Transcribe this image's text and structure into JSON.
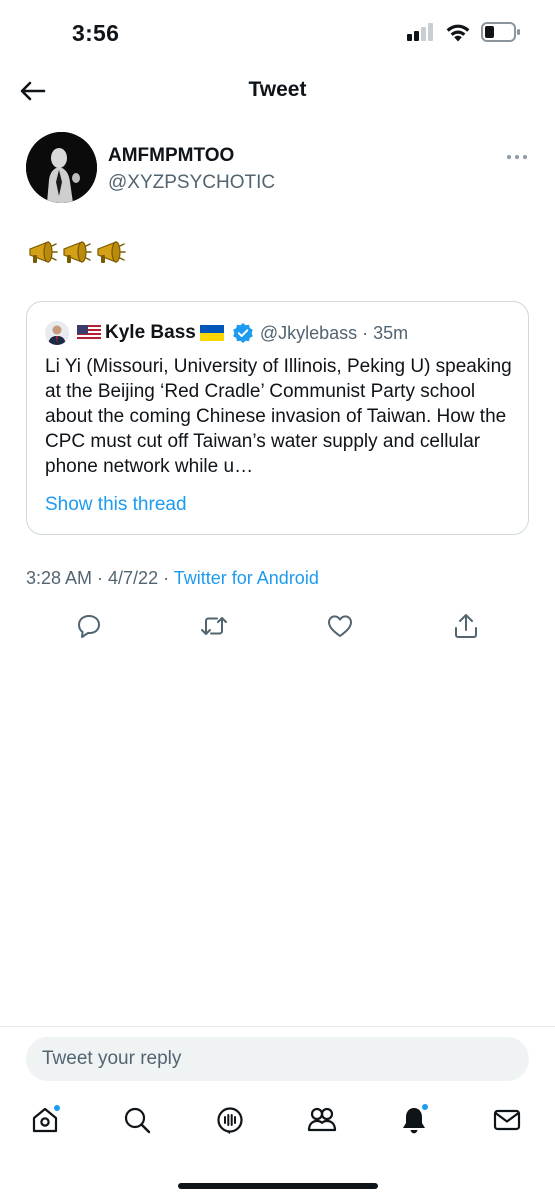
{
  "status_bar": {
    "time": "3:56"
  },
  "header": {
    "title": "Tweet"
  },
  "tweet": {
    "author_name": "AMFMPMTOO",
    "author_handle": "@XYZPSYCHOTIC",
    "body_emoji": "📣📣📣",
    "timestamp": "3:28 AM · 4/7/22 · ",
    "source": "Twitter for Android"
  },
  "quote": {
    "flag_prefix": "🇺🇸",
    "name": "Kyle Bass",
    "flag_suffix": "🇺🇦",
    "handle_time": "@Jkylebass · 35m",
    "text": "Li Yi (Missouri, University of Illinois, Peking U) speaking at the Beijing ‘Red Cradle’ Communist Party school about the coming Chinese invasion of Taiwan. How the CPC must cut off Taiwan’s water supply and cellular phone network while u…",
    "show_thread": "Show this thread"
  },
  "reply": {
    "placeholder": "Tweet your reply"
  },
  "colors": {
    "accent": "#1d9bf0",
    "secondary_text": "#536471"
  }
}
